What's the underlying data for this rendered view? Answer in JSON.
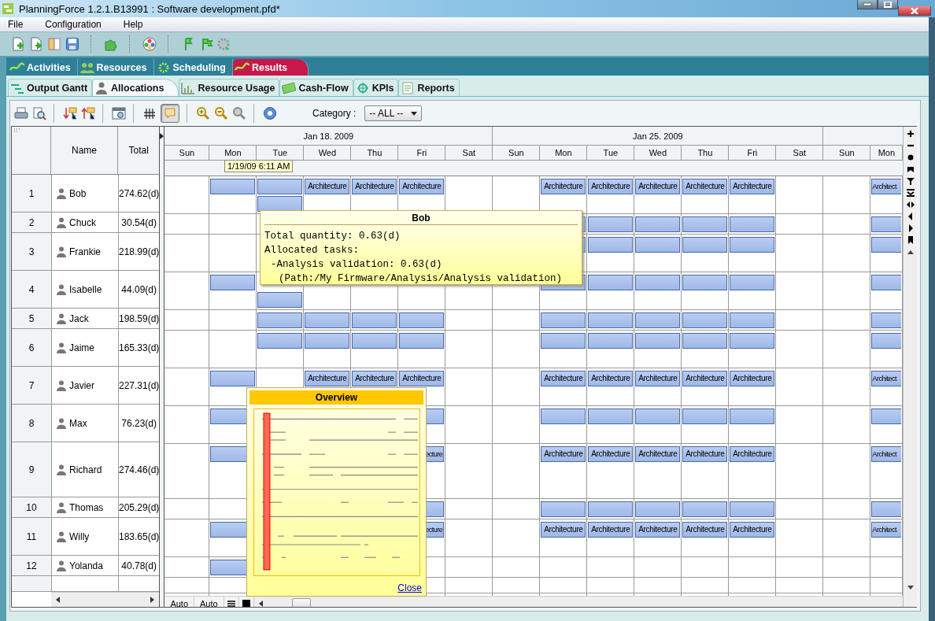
{
  "window": {
    "title": "PlanningForce 1.2.1.B13991 : Software development.pfd*"
  },
  "menu": [
    "File",
    "Configuration",
    "Help"
  ],
  "main_tabs": [
    {
      "label": "Activities",
      "selected": false
    },
    {
      "label": "Resources",
      "selected": false
    },
    {
      "label": "Scheduling",
      "selected": false
    },
    {
      "label": "Results",
      "selected": true
    }
  ],
  "sub_tabs": [
    {
      "label": "Output Gantt",
      "selected": false
    },
    {
      "label": "Allocations",
      "selected": true
    },
    {
      "label": "Resource Usage",
      "selected": false
    },
    {
      "label": "Cash-Flow",
      "selected": false
    },
    {
      "label": "KPIs",
      "selected": false
    },
    {
      "label": "Reports",
      "selected": false
    }
  ],
  "view_toolbar": {
    "tooltips_toggle": {
      "on": true
    },
    "category": {
      "label": "Category :",
      "value": "-- ALL --"
    }
  },
  "table": {
    "columns": [
      "Name",
      "Total"
    ],
    "weeks": [
      {
        "label": "Jan 18. 2009"
      },
      {
        "label": "Jan 25. 2009"
      }
    ],
    "days": [
      "Sun",
      "Mon",
      "Tue",
      "Wed",
      "Thu",
      "Fri",
      "Sat",
      "Sun",
      "Mon",
      "Tue",
      "Wed",
      "Thu",
      "Fri",
      "Sat",
      "Sun",
      "Mon"
    ],
    "date_marker": "1/19/09 6:11 AM",
    "rows": [
      {
        "number": "1",
        "name": "Bob",
        "total": "274.62(d)",
        "tall": true,
        "extra_tall": false,
        "cells": [
          {},
          {
            "bar": true
          },
          {
            "bar": true,
            "second_bar": true
          },
          {
            "bar": true,
            "text": "Architecture"
          },
          {
            "bar": true,
            "text": "Architecture"
          },
          {
            "bar": true,
            "text": "Architecture"
          },
          {},
          {},
          {
            "bar": true,
            "text": "Architecture"
          },
          {
            "bar": true,
            "text": "Architecture"
          },
          {
            "bar": true,
            "text": "Architecture"
          },
          {
            "bar": true,
            "text": "Architecture"
          },
          {
            "bar": true,
            "text": "Architecture"
          },
          {},
          {},
          {
            "bar": true,
            "text": "Architect"
          }
        ]
      },
      {
        "number": "2",
        "name": "Chuck",
        "total": "30.54(d)",
        "tall": false,
        "extra_tall": false,
        "cells": [
          {},
          {},
          {},
          {},
          {},
          {},
          {},
          {},
          {
            "bar": true
          },
          {
            "bar": true
          },
          {
            "bar": true
          },
          {
            "bar": true
          },
          {
            "bar": true
          },
          {},
          {},
          {
            "bar": true
          }
        ]
      },
      {
        "number": "3",
        "name": "Frankie",
        "total": "218.99(d)",
        "tall": true,
        "extra_tall": false,
        "cells": [
          {},
          {},
          {},
          {},
          {},
          {},
          {},
          {},
          {
            "bar": true
          },
          {
            "bar": true
          },
          {
            "bar": true
          },
          {
            "bar": true
          },
          {
            "bar": true
          },
          {},
          {},
          {
            "bar": true
          }
        ]
      },
      {
        "number": "4",
        "name": "Isabelle",
        "total": "44.09(d)",
        "tall": true,
        "extra_tall": false,
        "cells": [
          {},
          {
            "bar": true
          },
          {
            "second_bar": true
          },
          {},
          {},
          {},
          {},
          {},
          {
            "bar": true
          },
          {
            "bar": true
          },
          {
            "bar": true
          },
          {
            "bar": true
          },
          {
            "bar": true
          },
          {},
          {},
          {
            "bar": true
          }
        ]
      },
      {
        "number": "5",
        "name": "Jack",
        "total": "198.59(d)",
        "tall": false,
        "extra_tall": false,
        "cells": [
          {},
          {},
          {
            "bar": true
          },
          {
            "bar": true
          },
          {
            "bar": true
          },
          {
            "bar": true
          },
          {},
          {},
          {
            "bar": true
          },
          {
            "bar": true
          },
          {
            "bar": true
          },
          {
            "bar": true
          },
          {
            "bar": true
          },
          {},
          {},
          {
            "bar": true
          }
        ]
      },
      {
        "number": "6",
        "name": "Jaime",
        "total": "165.33(d)",
        "tall": true,
        "extra_tall": false,
        "cells": [
          {},
          {},
          {
            "bar": true
          },
          {
            "bar": true
          },
          {
            "bar": true
          },
          {
            "bar": true
          },
          {},
          {},
          {
            "bar": true
          },
          {
            "bar": true
          },
          {
            "bar": true
          },
          {
            "bar": true
          },
          {
            "bar": true
          },
          {},
          {},
          {
            "bar": true
          }
        ]
      },
      {
        "number": "7",
        "name": "Javier",
        "total": "227.31(d)",
        "tall": true,
        "extra_tall": false,
        "cells": [
          {},
          {
            "bar": true
          },
          {},
          {
            "bar": true,
            "text": "Architecture"
          },
          {
            "bar": true,
            "text": "Architecture"
          },
          {
            "bar": true,
            "text": "Architecture"
          },
          {},
          {},
          {
            "bar": true,
            "text": "Architecture"
          },
          {
            "bar": true,
            "text": "Architecture"
          },
          {
            "bar": true,
            "text": "Architecture"
          },
          {
            "bar": true,
            "text": "Architecture"
          },
          {
            "bar": true,
            "text": "Architecture"
          },
          {},
          {},
          {
            "bar": true,
            "text": "Architect"
          }
        ]
      },
      {
        "number": "8",
        "name": "Max",
        "total": "76.23(d)",
        "tall": true,
        "extra_tall": false,
        "cells": [
          {},
          {
            "bar": true
          },
          {},
          {},
          {},
          {
            "bar": true
          },
          {},
          {},
          {
            "bar": true
          },
          {
            "bar": true
          },
          {
            "bar": true
          },
          {
            "bar": true
          },
          {
            "bar": true
          },
          {},
          {},
          {
            "bar": true
          }
        ]
      },
      {
        "number": "9",
        "name": "Richard",
        "total": "274.46(d)",
        "tall": true,
        "extra_tall": true,
        "cells": [
          {},
          {
            "bar": true
          },
          {},
          {},
          {},
          {
            "bar": true,
            "text": "ecture",
            "partial": true
          },
          {},
          {},
          {
            "bar": true,
            "text": "Architecture"
          },
          {
            "bar": true,
            "text": "Architecture"
          },
          {
            "bar": true,
            "text": "Architecture"
          },
          {
            "bar": true,
            "text": "Architecture"
          },
          {
            "bar": true,
            "text": "Architecture"
          },
          {},
          {},
          {
            "bar": true,
            "text": "Architect"
          }
        ]
      },
      {
        "number": "10",
        "name": "Thomas",
        "total": "205.29(d)",
        "tall": false,
        "extra_tall": false,
        "cells": [
          {},
          {},
          {},
          {},
          {},
          {
            "bar": true
          },
          {},
          {},
          {
            "bar": true
          },
          {
            "bar": true
          },
          {
            "bar": true
          },
          {
            "bar": true
          },
          {
            "bar": true
          },
          {},
          {},
          {
            "bar": true
          }
        ]
      },
      {
        "number": "11",
        "name": "Willy",
        "total": "183.65(d)",
        "tall": true,
        "extra_tall": false,
        "cells": [
          {},
          {
            "bar": true
          },
          {},
          {},
          {},
          {
            "bar": true,
            "text": "ecture",
            "partial": true
          },
          {},
          {},
          {
            "bar": true,
            "text": "Architecture"
          },
          {
            "bar": true,
            "text": "Architecture"
          },
          {
            "bar": true,
            "text": "Architecture"
          },
          {
            "bar": true,
            "text": "Architecture"
          },
          {
            "bar": true,
            "text": "Architecture"
          },
          {},
          {},
          {
            "bar": true,
            "text": "Architect"
          }
        ]
      },
      {
        "number": "12",
        "name": "Yolanda",
        "total": "40.78(d)",
        "tall": false,
        "extra_tall": false,
        "cells": [
          {},
          {
            "bar": true
          },
          {},
          {},
          {},
          {},
          {},
          {},
          {},
          {},
          {},
          {},
          {},
          {},
          {},
          {}
        ]
      }
    ]
  },
  "tooltip": {
    "title": "Bob",
    "lines": [
      {
        "kind": "text",
        "text": "Total quantity: 0.63(d)"
      },
      {
        "kind": "text",
        "text": "Allocated tasks:"
      },
      {
        "kind": "task",
        "text": "-Analysis validation: 0.63(d)"
      },
      {
        "kind": "path",
        "text": "(Path:/My Firmware/Analysis/Analysis validation)"
      }
    ]
  },
  "overview": {
    "title": "Overview",
    "link": "Close"
  },
  "footer": {
    "buttons": [
      "Auto",
      "Auto"
    ]
  }
}
